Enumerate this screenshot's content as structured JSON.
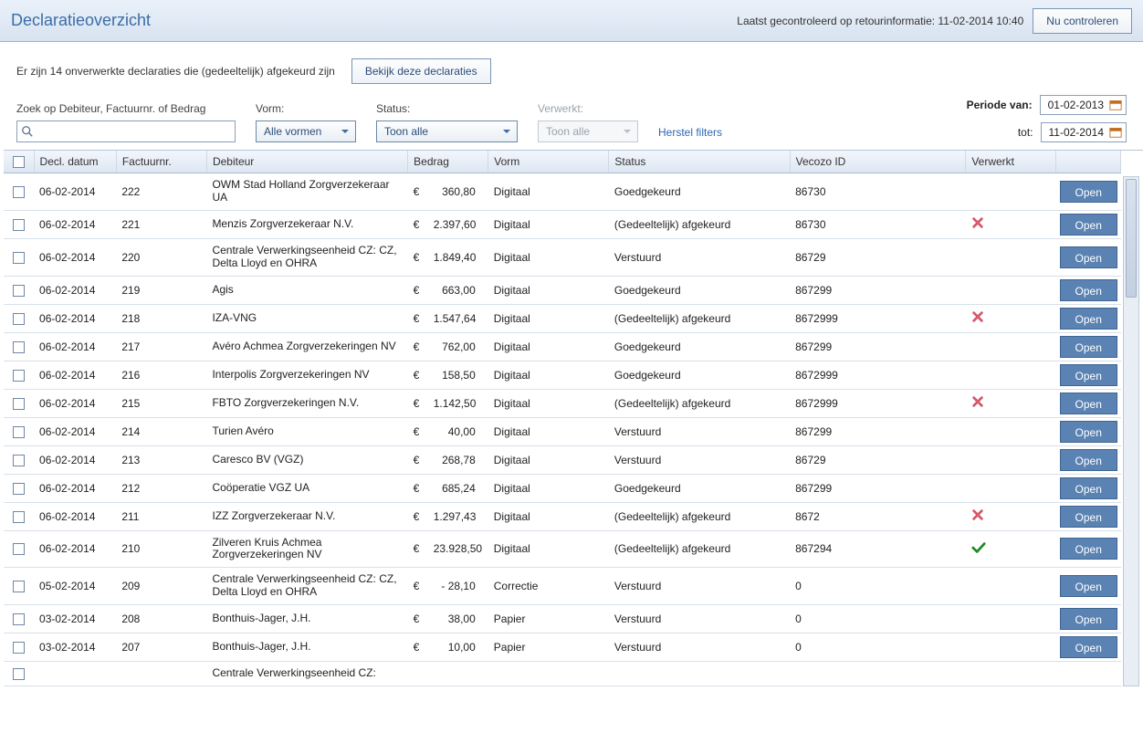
{
  "header": {
    "title": "Declaratieoverzicht",
    "status_prefix": "Laatst gecontroleerd op retourinformatie:",
    "status_time": "11-02-2014 10:40",
    "check_button": "Nu controleren"
  },
  "infobar": {
    "message": "Er zijn 14 onverwerkte declaraties die (gedeeltelijk) afgekeurd zijn",
    "view_button": "Bekijk deze declaraties"
  },
  "filters": {
    "search_label": "Zoek op Debiteur, Factuurnr. of Bedrag",
    "search_value": "",
    "vorm_label": "Vorm:",
    "vorm_selected": "Alle vormen",
    "status_label": "Status:",
    "status_selected": "Toon alle",
    "verwerkt_label": "Verwerkt:",
    "verwerkt_selected": "Toon alle",
    "reset_link": "Herstel filters",
    "period_from_label": "Periode van:",
    "period_from_value": "01-02-2013",
    "period_to_label": "tot:",
    "period_to_value": "11-02-2014"
  },
  "columns": {
    "date": "Decl. datum",
    "factuur": "Factuurnr.",
    "debiteur": "Debiteur",
    "bedrag": "Bedrag",
    "vorm": "Vorm",
    "status": "Status",
    "vecozo": "Vecozo ID",
    "verwerkt": "Verwerkt",
    "open": "Open"
  },
  "currency": "€",
  "rows": [
    {
      "date": "06-02-2014",
      "fact": "222",
      "deb": "OWM Stad Holland Zorgverzekeraar UA",
      "amt": "360,80",
      "vorm": "Digitaal",
      "status": "Goedgekeurd",
      "vecozo": "86730",
      "verw": ""
    },
    {
      "date": "06-02-2014",
      "fact": "221",
      "deb": "Menzis Zorgverzekeraar N.V.",
      "amt": "2.397,60",
      "vorm": "Digitaal",
      "status": "(Gedeeltelijk) afgekeurd",
      "vecozo": "86730",
      "verw": "x"
    },
    {
      "date": "06-02-2014",
      "fact": "220",
      "deb": "Centrale Verwerkingseenheid CZ: CZ, Delta Lloyd en OHRA",
      "amt": "1.849,40",
      "vorm": "Digitaal",
      "status": "Verstuurd",
      "vecozo": "86729",
      "verw": ""
    },
    {
      "date": "06-02-2014",
      "fact": "219",
      "deb": "Agis",
      "amt": "663,00",
      "vorm": "Digitaal",
      "status": "Goedgekeurd",
      "vecozo": "867299",
      "verw": ""
    },
    {
      "date": "06-02-2014",
      "fact": "218",
      "deb": "IZA-VNG",
      "amt": "1.547,64",
      "vorm": "Digitaal",
      "status": "(Gedeeltelijk) afgekeurd",
      "vecozo": "8672999",
      "verw": "x"
    },
    {
      "date": "06-02-2014",
      "fact": "217",
      "deb": "Avéro Achmea Zorgverzekeringen NV",
      "amt": "762,00",
      "vorm": "Digitaal",
      "status": "Goedgekeurd",
      "vecozo": "867299",
      "verw": ""
    },
    {
      "date": "06-02-2014",
      "fact": "216",
      "deb": "Interpolis Zorgverzekeringen NV",
      "amt": "158,50",
      "vorm": "Digitaal",
      "status": "Goedgekeurd",
      "vecozo": "8672999",
      "verw": ""
    },
    {
      "date": "06-02-2014",
      "fact": "215",
      "deb": "FBTO Zorgverzekeringen N.V.",
      "amt": "1.142,50",
      "vorm": "Digitaal",
      "status": "(Gedeeltelijk) afgekeurd",
      "vecozo": "8672999",
      "verw": "x"
    },
    {
      "date": "06-02-2014",
      "fact": "214",
      "deb": "Turien Avéro",
      "amt": "40,00",
      "vorm": "Digitaal",
      "status": "Verstuurd",
      "vecozo": "867299",
      "verw": ""
    },
    {
      "date": "06-02-2014",
      "fact": "213",
      "deb": "Caresco BV (VGZ)",
      "amt": "268,78",
      "vorm": "Digitaal",
      "status": "Verstuurd",
      "vecozo": "86729",
      "verw": ""
    },
    {
      "date": "06-02-2014",
      "fact": "212",
      "deb": "Coöperatie VGZ UA",
      "amt": "685,24",
      "vorm": "Digitaal",
      "status": "Goedgekeurd",
      "vecozo": "867299",
      "verw": ""
    },
    {
      "date": "06-02-2014",
      "fact": "211",
      "deb": "IZZ Zorgverzekeraar N.V.",
      "amt": "1.297,43",
      "vorm": "Digitaal",
      "status": "(Gedeeltelijk) afgekeurd",
      "vecozo": "8672",
      "verw": "x"
    },
    {
      "date": "06-02-2014",
      "fact": "210",
      "deb": "Zilveren Kruis Achmea Zorgverzekeringen NV",
      "amt": "23.928,50",
      "vorm": "Digitaal",
      "status": "(Gedeeltelijk) afgekeurd",
      "vecozo": "867294",
      "verw": "v"
    },
    {
      "date": "05-02-2014",
      "fact": "209",
      "deb": "Centrale Verwerkingseenheid CZ: CZ, Delta Lloyd en OHRA",
      "amt": "- 28,10",
      "vorm": "Correctie",
      "status": "Verstuurd",
      "vecozo": "0",
      "verw": ""
    },
    {
      "date": "03-02-2014",
      "fact": "208",
      "deb": "Bonthuis-Jager, J.H.",
      "amt": "38,00",
      "vorm": "Papier",
      "status": "Verstuurd",
      "vecozo": "0",
      "verw": ""
    },
    {
      "date": "03-02-2014",
      "fact": "207",
      "deb": "Bonthuis-Jager, J.H.",
      "amt": "10,00",
      "vorm": "Papier",
      "status": "Verstuurd",
      "vecozo": "0",
      "verw": ""
    }
  ],
  "partial_row": {
    "deb": "Centrale Verwerkingseenheid CZ:"
  }
}
